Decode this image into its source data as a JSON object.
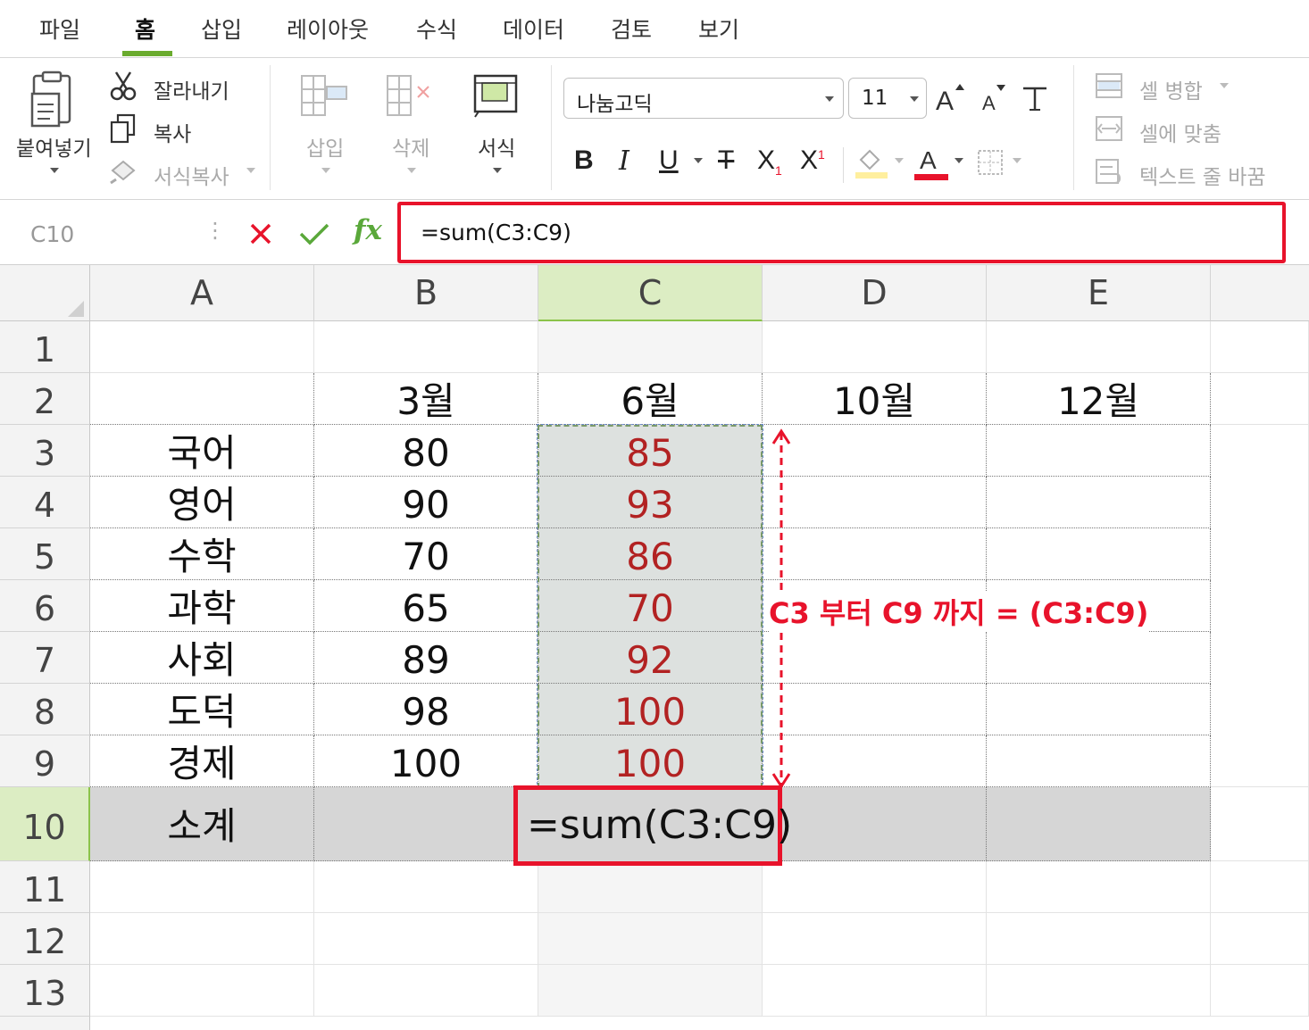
{
  "menu": {
    "tabs": [
      "파일",
      "홈",
      "삽입",
      "레이아웃",
      "수식",
      "데이터",
      "검토",
      "보기"
    ],
    "active": "홈"
  },
  "ribbon": {
    "paste_label": "붙여넣기",
    "cut_label": "잘라내기",
    "copy_label": "복사",
    "format_painter_label": "서식복사",
    "insert_label": "삽입",
    "delete_label": "삭제",
    "format_label": "서식",
    "font_name": "나눔고딕",
    "font_size": "11",
    "merge_label": "셀 병합",
    "fit_label": "셀에 맞춤",
    "wrap_label": "텍스트 줄 바꿈",
    "fill_color": "#ffef9e",
    "font_color": "#e8132b"
  },
  "formula_bar": {
    "cell_ref": "C10",
    "formula": "=sum(C3:C9)"
  },
  "sheet": {
    "columns": [
      "A",
      "B",
      "C",
      "D",
      "E"
    ],
    "selected_column": "C",
    "rows": [
      "1",
      "2",
      "3",
      "4",
      "5",
      "6",
      "7",
      "8",
      "9",
      "10",
      "11",
      "12",
      "13"
    ],
    "selected_row": "10",
    "headers": {
      "b": "3월",
      "c": "6월",
      "d": "10월",
      "e": "12월"
    },
    "subjects": [
      "국어",
      "영어",
      "수학",
      "과학",
      "사회",
      "도덕",
      "경제"
    ],
    "march": [
      "80",
      "90",
      "70",
      "65",
      "89",
      "98",
      "100"
    ],
    "june": [
      "85",
      "93",
      "86",
      "70",
      "92",
      "100",
      "100"
    ],
    "total_label": "소계",
    "total_formula": "=sum(C3:C9)",
    "annotation": "C3 부터 C9 까지 =  (C3:C9)"
  }
}
